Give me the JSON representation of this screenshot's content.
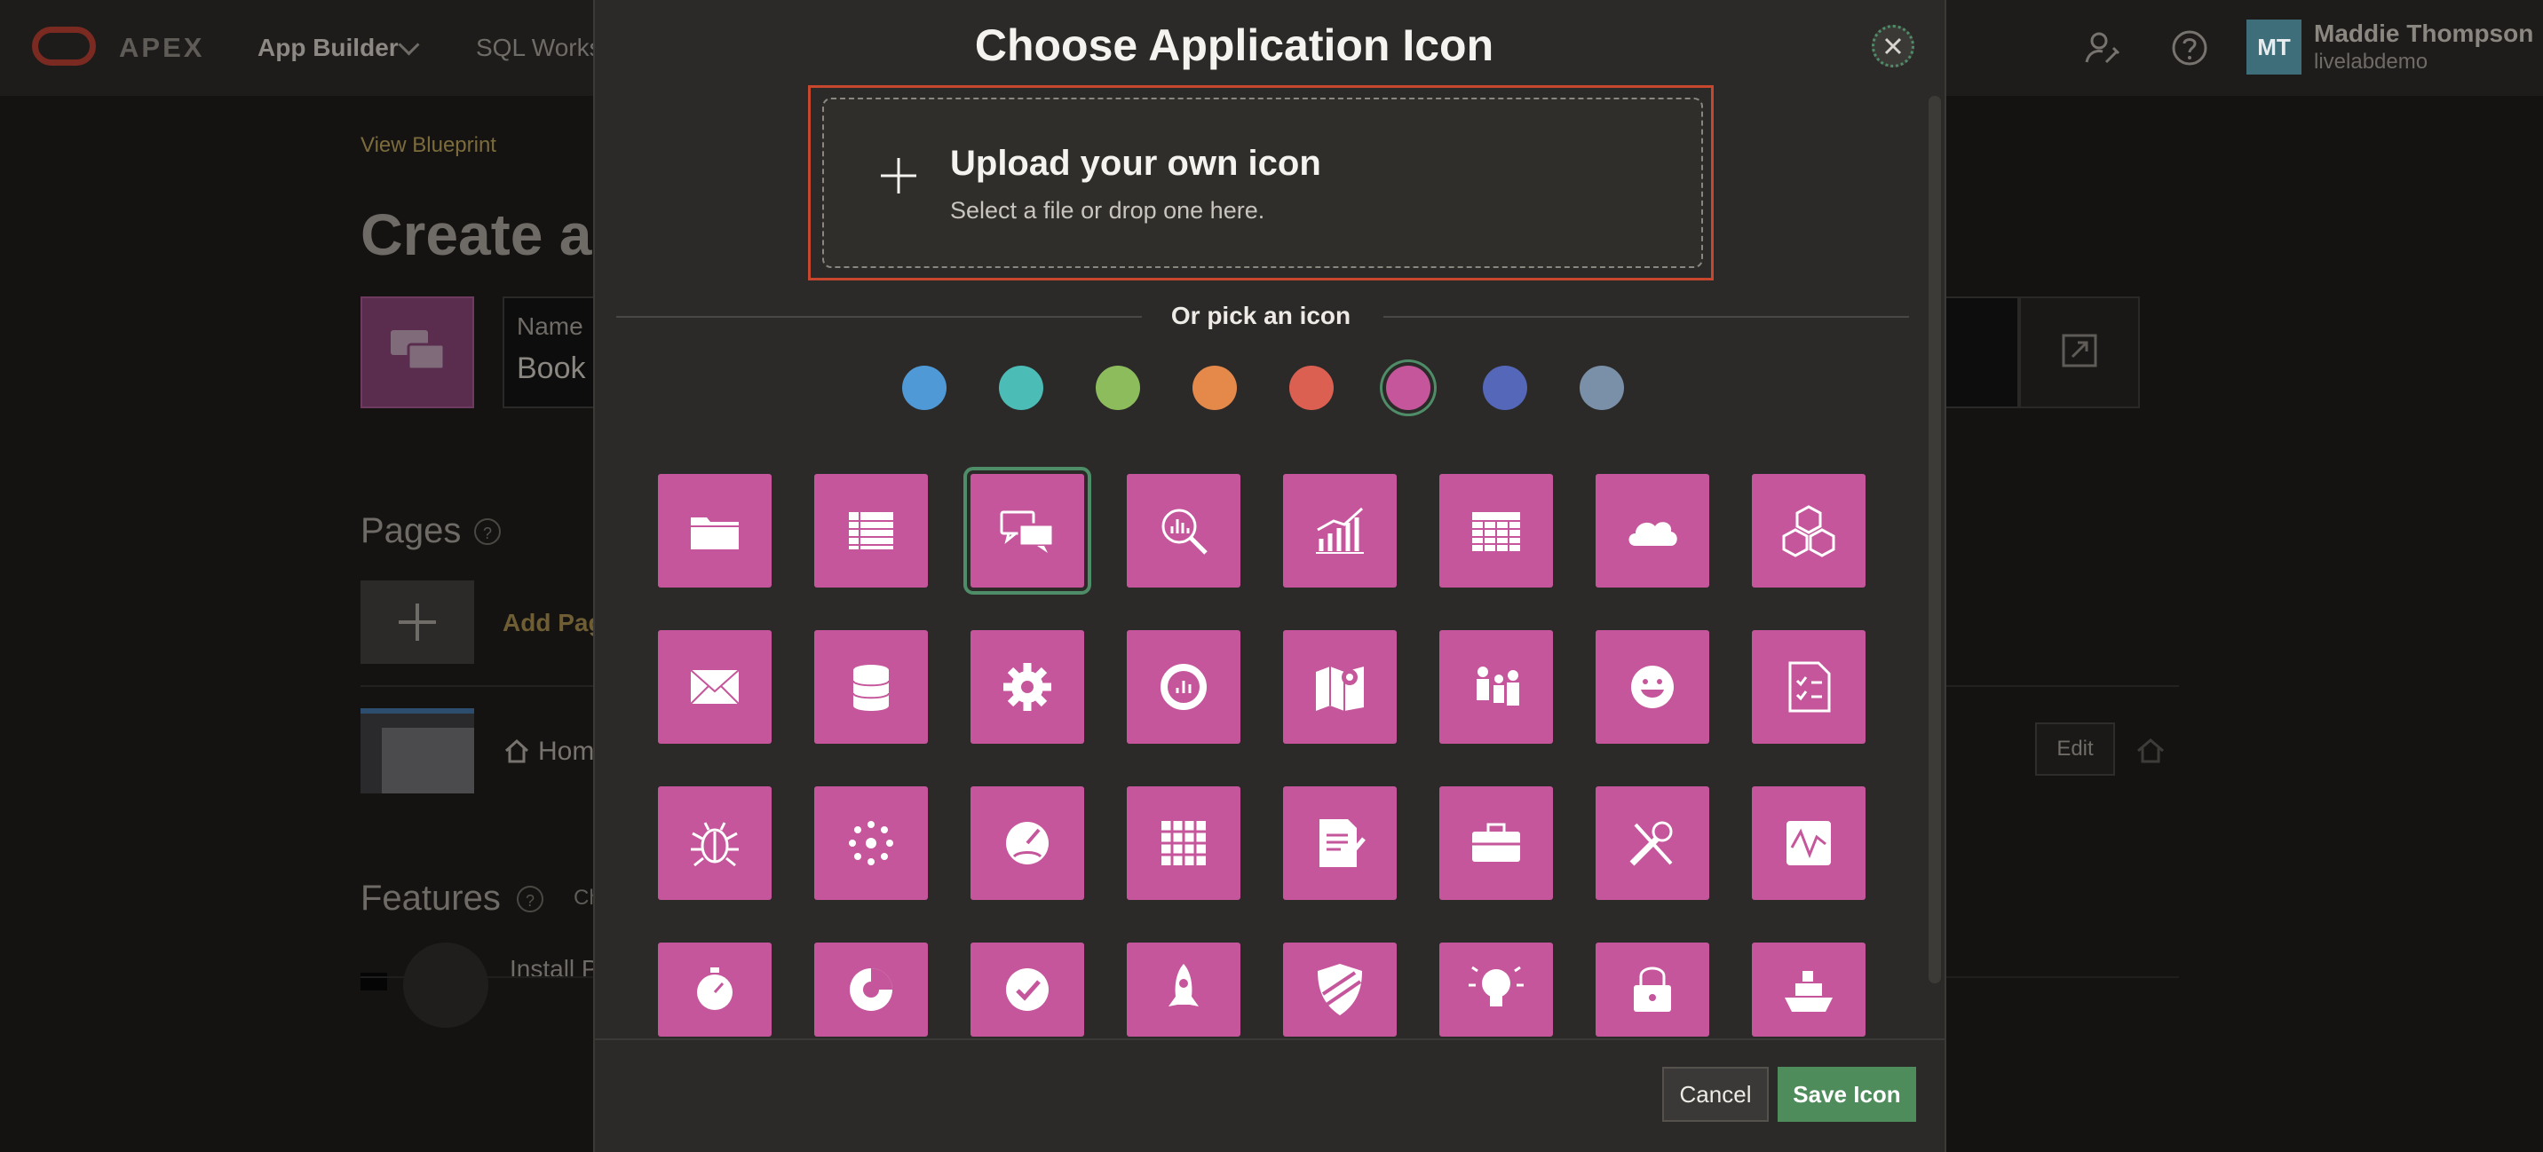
{
  "header": {
    "brand": "APEX",
    "nav_app_builder": "App Builder",
    "nav_sql_workshop": "SQL Worksh",
    "user_initials": "MT",
    "user_name": "Maddie Thompson",
    "user_workspace": "livelabdemo"
  },
  "page": {
    "view_blueprint": "View Blueprint",
    "title": "Create ar",
    "name_label": "Name",
    "name_value": "Book",
    "pages_heading": "Pages",
    "add_page": "Add Pag",
    "home_page": "Hom",
    "edit_label": "Edit",
    "features_heading": "Features",
    "features_extra": "Ch",
    "install_label": "Install P"
  },
  "modal": {
    "title": "Choose Application Icon",
    "upload_title": "Upload your own icon",
    "upload_subtitle": "Select a file or drop one here.",
    "or_pick": "Or pick an icon",
    "cancel_label": "Cancel",
    "save_label": "Save Icon",
    "selected_color": "pink",
    "selected_icon": "chat-bubbles-icon"
  },
  "swatches": [
    {
      "name": "blue",
      "color": "#4f9ad6"
    },
    {
      "name": "teal",
      "color": "#4bbcb6"
    },
    {
      "name": "green",
      "color": "#8cbc5c"
    },
    {
      "name": "orange",
      "color": "#e5894a"
    },
    {
      "name": "red",
      "color": "#dc6052"
    },
    {
      "name": "pink",
      "color": "#c5569b"
    },
    {
      "name": "indigo",
      "color": "#5467b8"
    },
    {
      "name": "slate",
      "color": "#7a90a8"
    }
  ],
  "colors": {
    "tile": "#c5569b",
    "accent_green": "#4e8c5b",
    "upload_border": "#c7472e"
  },
  "icons": [
    "folder-icon",
    "spreadsheet-icon",
    "chat-bubbles-icon",
    "search-chart-icon",
    "line-bar-chart-icon",
    "calendar-grid-icon",
    "cloud-icon",
    "cubes-icon",
    "envelope-icon",
    "database-icon",
    "gear-icon",
    "donut-chart-icon",
    "map-pin-icon",
    "people-icon",
    "smiley-icon",
    "checklist-doc-icon",
    "bug-icon",
    "dots-cluster-icon",
    "gauge-icon",
    "grid-cells-icon",
    "edit-document-icon",
    "briefcase-icon",
    "tools-icon",
    "pulse-line-icon",
    "stopwatch-icon",
    "pie-chart-icon",
    "check-circle-icon",
    "rocket-icon",
    "shield-icon",
    "lightbulb-icon",
    "lock-icon",
    "ship-icon"
  ]
}
